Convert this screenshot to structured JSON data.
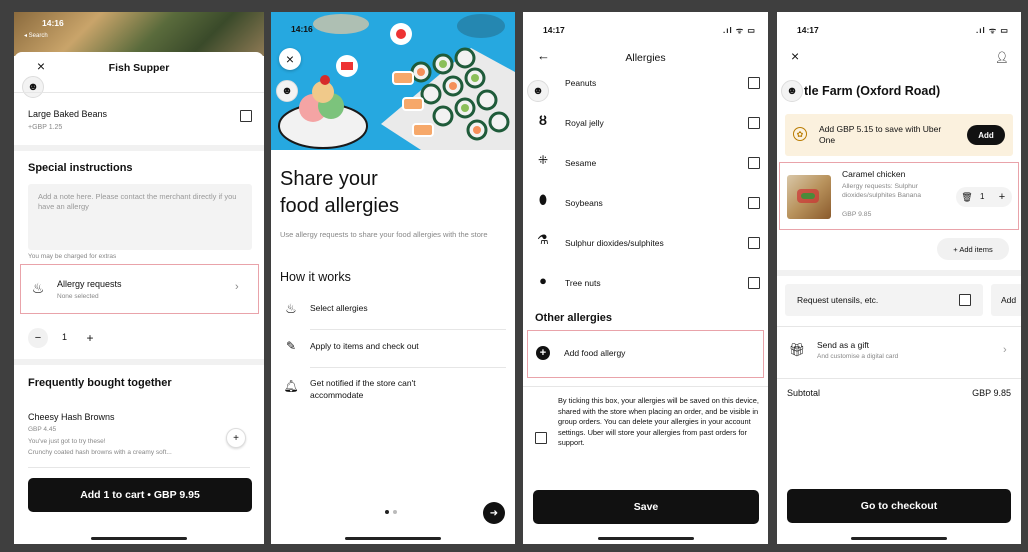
{
  "p1": {
    "status_time": "14:16",
    "search_label": "◂ Search",
    "close_icon": "×",
    "title": "Fish Supper",
    "beans": {
      "name": "Large Baked Beans",
      "price": "+GBP 1.25"
    },
    "special_heading": "Special instructions",
    "note_placeholder": "Add a note here. Please contact the merchant directly if you have an allergy",
    "charged_note": "You may be charged for extras",
    "allergy": {
      "title": "Allergy requests",
      "subtitle": "None selected"
    },
    "qty": {
      "minus": "−",
      "value": "1",
      "plus": "+"
    },
    "freq_heading": "Frequently bought together",
    "cheesy": {
      "name": "Cheesy Hash Browns",
      "price": "GBP 4.45",
      "line1": "You've just got to try these!",
      "line2": "Crunchy coated hash browns with a creamy soft...",
      "add": "+"
    },
    "add_btn": "Add 1 to cart • GBP 9.95"
  },
  "p2": {
    "status_time": "14:16",
    "close_icon": "×",
    "heading_line1": "Share your",
    "heading_line2": "food allergies",
    "desc": "Use allergy requests to share your food allergies with the store",
    "how_heading": "How it works",
    "steps": [
      "Select allergies",
      "Apply to items and check out",
      "Get notified if the store can't accommodate"
    ],
    "next_icon": "➜"
  },
  "p3": {
    "status_time": "14:17",
    "back_icon": "←",
    "title": "Allergies",
    "items": [
      "Peanuts",
      "Royal jelly",
      "Sesame",
      "Soybeans",
      "Sulphur dioxides/sulphites",
      "Tree nuts"
    ],
    "other_heading": "Other allergies",
    "add_allergy": "Add food allergy",
    "add_allergy_icon": "+",
    "consent": "By ticking this box, your allergies will be saved on this device, shared with the store when placing an order, and be visible in group orders. You can delete your allergies in your account settings. Uber will store your allergies from past orders for support.",
    "save_btn": "Save"
  },
  "p4": {
    "status_time": "14:17",
    "close_icon": "×",
    "store": "tle Farm (Oxford Road)",
    "promo": {
      "text": "Add GBP 5.15 to save with Uber One",
      "btn": "Add"
    },
    "item": {
      "name": "Caramel chicken",
      "allergy": "Allergy requests: Sulphur dioxides/sulphites Banana",
      "price": "GBP 9.85",
      "qty": "1",
      "plus": "+"
    },
    "add_items": "+ Add items",
    "utensils": "Request utensils, etc.",
    "add_partial": "Add",
    "gift": {
      "title": "Send as a gift",
      "subtitle": "And customise a digital card"
    },
    "subtotal_label": "Subtotal",
    "subtotal_value": "GBP 9.85",
    "checkout_btn": "Go to checkout"
  },
  "colors": {
    "highlight": "#e9a3aa",
    "promo_bg": "#fbf1de",
    "dark": "#111111",
    "illus_bg": "#26a8e0"
  }
}
